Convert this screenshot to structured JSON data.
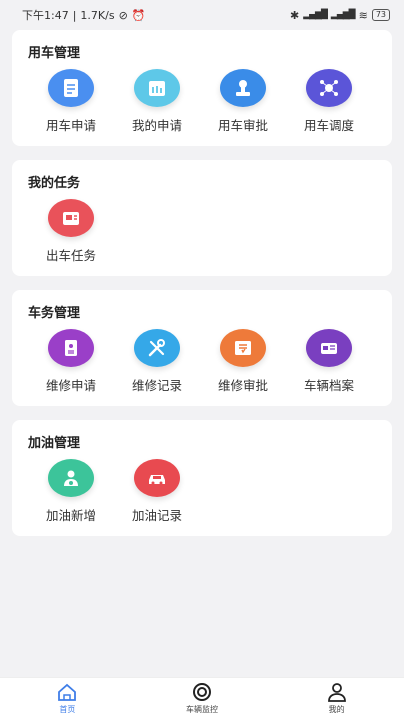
{
  "status_bar": {
    "time": "下午1:47",
    "speed": "1.7K/s",
    "battery": "73"
  },
  "sections": [
    {
      "title": "用车管理",
      "items": [
        {
          "label": "用车申请",
          "icon": "document-edit-icon",
          "color": "#4a8ff0"
        },
        {
          "label": "我的申请",
          "icon": "calendar-icon",
          "color": "#5ec8e8"
        },
        {
          "label": "用车审批",
          "icon": "stamp-icon",
          "color": "#3a8ce8"
        },
        {
          "label": "用车调度",
          "icon": "network-icon",
          "color": "#5b55d8"
        }
      ]
    },
    {
      "title": "我的任务",
      "items": [
        {
          "label": "出车任务",
          "icon": "vehicle-task-icon",
          "color": "#e9525a"
        }
      ]
    },
    {
      "title": "车务管理",
      "items": [
        {
          "label": "维修申请",
          "icon": "repair-form-icon",
          "color": "#9a3fc8"
        },
        {
          "label": "维修记录",
          "icon": "tools-icon",
          "color": "#35a8e8"
        },
        {
          "label": "维修审批",
          "icon": "approval-board-icon",
          "color": "#ee7a3a"
        },
        {
          "label": "车辆档案",
          "icon": "truck-file-icon",
          "color": "#7a3fc0"
        }
      ]
    },
    {
      "title": "加油管理",
      "items": [
        {
          "label": "加油新增",
          "icon": "driver-add-icon",
          "color": "#3cc49a"
        },
        {
          "label": "加油记录",
          "icon": "car-icon",
          "color": "#e84a50"
        }
      ]
    }
  ],
  "tab_bar": {
    "items": [
      {
        "label": "首页",
        "icon": "home-icon"
      },
      {
        "label": "车辆监控",
        "icon": "monitor-icon"
      },
      {
        "label": "我的",
        "icon": "user-icon"
      }
    ],
    "active_color": "#3f7ee8"
  }
}
